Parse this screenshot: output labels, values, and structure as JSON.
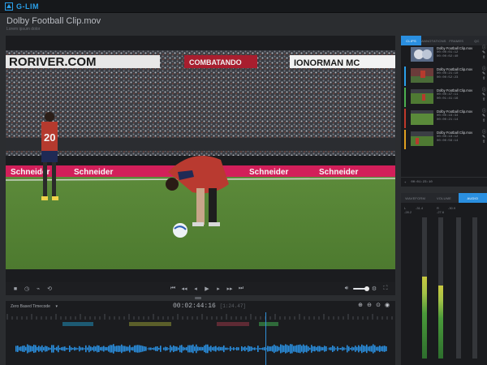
{
  "app": {
    "brand": "G-LIM",
    "logo_icon": "app-logo-icon"
  },
  "clip": {
    "title": "Dolby Football Clip.mov",
    "subtitle": "Lorem ipsum dolor"
  },
  "video": {
    "banner_top_left": "RORIVER.COM",
    "banner_top_mid": "COMBATANDO",
    "banner_top_right": "IONORMAN MC",
    "ads": [
      "Schneider",
      "Schneider",
      "Schneider",
      "Schneider"
    ],
    "player_number": "20"
  },
  "transport": {
    "left_icons": [
      "stop-icon",
      "clock-icon",
      "fps-icon",
      "loop-icon"
    ],
    "center_icons": [
      "jump-start-icon",
      "prev-frame-icon",
      "step-back-icon",
      "play-icon",
      "step-forward-icon",
      "next-frame-icon",
      "jump-end-icon"
    ],
    "right_icons": [
      "volume-icon",
      "settings-icon",
      "fullscreen-icon"
    ],
    "volume_level": 0.85
  },
  "timeline": {
    "select_label": "Zero Based Timecode",
    "timecode": "00:02:44:16",
    "timecode_sub": "[1:24.47]",
    "tools": [
      "zoom-in-icon",
      "zoom-out-icon",
      "zoom-fit-icon",
      "visibility-icon"
    ],
    "playhead_position": 0.667
  },
  "clips_panel": {
    "tabs": [
      "CLIPS",
      "ANNOTATIONS",
      "FRAMES",
      "QC"
    ],
    "active_tab": 0,
    "items": [
      {
        "name": "Dolby Football Clip.mov",
        "tc_in": "00:00:01:12",
        "tc_out": "00:00:02:40",
        "color": "#1f1f1f"
      },
      {
        "name": "Dolby Football Clip.mov",
        "tc_in": "00:00:21:10",
        "tc_out": "00:00:52:23",
        "color": "#2aa0ea"
      },
      {
        "name": "Dolby Football Clip.mov",
        "tc_in": "00:00:47:11",
        "tc_out": "00:01:41:16",
        "color": "#4caf50"
      },
      {
        "name": "Dolby Football Clip.mov",
        "tc_in": "00:00:16:34",
        "tc_out": "00:00:21:14",
        "color": "#c0392b"
      },
      {
        "name": "Dolby Football Clip.mov",
        "tc_in": "00:00:18:12",
        "tc_out": "00:00:56:14",
        "color": "#e0a020"
      }
    ],
    "footer_tc": "00:01:23:10"
  },
  "audio_panel": {
    "tabs": [
      "WAVEFORM",
      "VOLUME",
      "AUDIO"
    ],
    "active_tab": 2,
    "channels": [
      {
        "label": "L",
        "peak": "-28.2",
        "rms": "-31.4",
        "level": 0.58
      },
      {
        "label": "R",
        "peak": "-27.6",
        "rms": "-30.9",
        "level": 0.52
      },
      {
        "label": "C",
        "peak": "",
        "rms": "",
        "level": 0
      },
      {
        "label": "LFE",
        "peak": "",
        "rms": "",
        "level": 0
      }
    ]
  }
}
